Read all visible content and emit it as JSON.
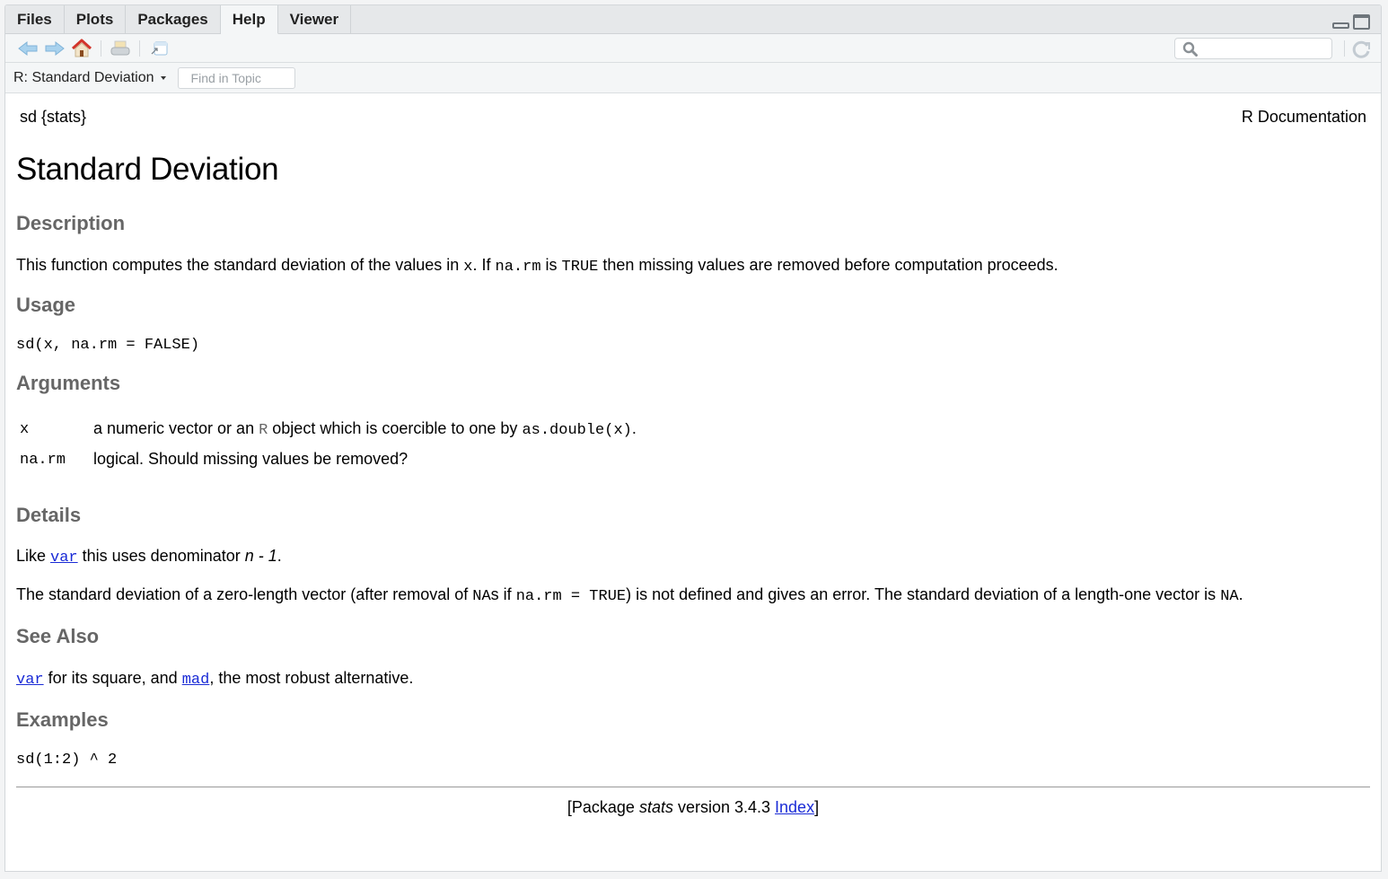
{
  "tabs": [
    {
      "label": "Files",
      "active": false
    },
    {
      "label": "Plots",
      "active": false
    },
    {
      "label": "Packages",
      "active": false
    },
    {
      "label": "Help",
      "active": true
    },
    {
      "label": "Viewer",
      "active": false
    }
  ],
  "toolbar": {
    "icons": [
      "back-arrow-icon",
      "forward-arrow-icon",
      "home-icon",
      "print-icon",
      "show-in-new-window-icon"
    ],
    "search_value": "",
    "search_placeholder": ""
  },
  "topic_bar": {
    "topic_label": "R: Standard Deviation",
    "find_placeholder": "Find in Topic"
  },
  "doc": {
    "header_left": "sd {stats}",
    "header_right": "R Documentation",
    "title": "Standard Deviation",
    "description": {
      "heading": "Description",
      "t1": "This function computes the standard deviation of the values in ",
      "c1": "x",
      "t2": ". If ",
      "c2": "na.rm",
      "t3": " is ",
      "c3": "TRUE",
      "t4": " then missing values are removed before computation proceeds."
    },
    "usage": {
      "heading": "Usage",
      "code": "sd(x, na.rm = FALSE)"
    },
    "arguments": {
      "heading": "Arguments",
      "items": [
        {
          "name": "x",
          "t1": "a numeric vector or an ",
          "r": "R",
          "t2": " object which is coercible to one by ",
          "code": "as.double(x)",
          "t3": "."
        },
        {
          "name": "na.rm",
          "t1": "logical. Should missing values be removed?"
        }
      ]
    },
    "details": {
      "heading": "Details",
      "p1_t1": "Like ",
      "p1_link": "var",
      "p1_t2": " this uses denominator ",
      "p1_em": "n - 1",
      "p1_t3": ".",
      "p2_t1": "The standard deviation of a zero-length vector (after removal of ",
      "p2_c1": "NA",
      "p2_t2": "s if ",
      "p2_c2": "na.rm = TRUE",
      "p2_t3": ") is not defined and gives an error. The standard deviation of a length-one vector is ",
      "p2_c3": "NA",
      "p2_t4": "."
    },
    "see_also": {
      "heading": "See Also",
      "link1": "var",
      "t1": " for its square, and ",
      "link2": "mad",
      "t2": ", the most robust alternative."
    },
    "examples": {
      "heading": "Examples",
      "code": "sd(1:2) ^ 2"
    },
    "footer": {
      "t1": "[Package ",
      "em": "stats",
      "t2": " version 3.4.3 ",
      "link": "Index",
      "t3": "]"
    }
  },
  "colors": {
    "link": "#1a2bd6",
    "heading": "#666666"
  }
}
